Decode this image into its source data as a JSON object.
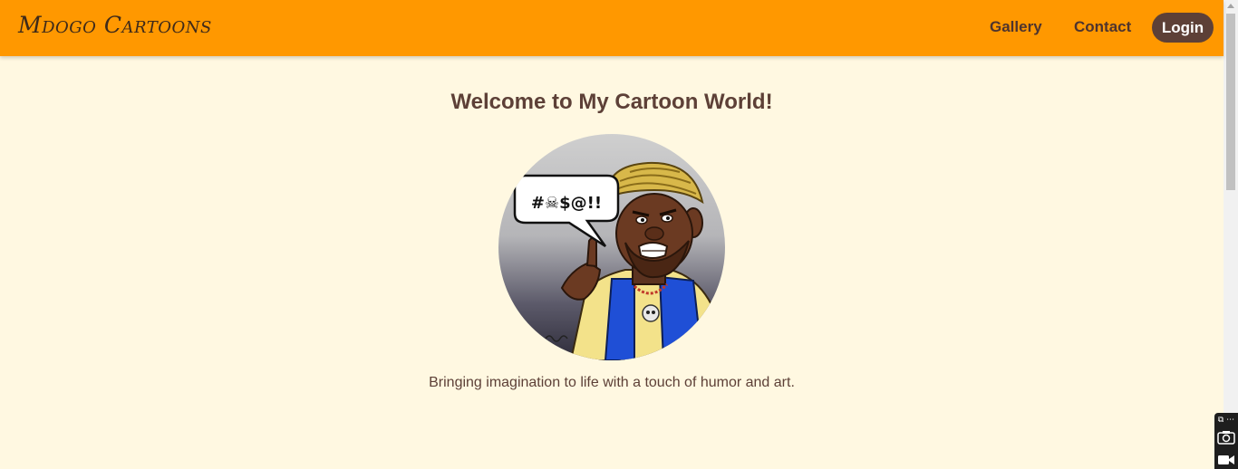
{
  "navbar": {
    "brand": "Mdogo Cartoons",
    "links": [
      "Gallery",
      "Contact"
    ],
    "login_label": "Login"
  },
  "hero": {
    "title": "Welcome to My Cartoon World!",
    "speech_text": "#☠$@!!",
    "tagline": "Bringing imagination to life with a touch of humor and art."
  },
  "colors": {
    "navbar_bg": "#ff9800",
    "page_bg": "#fff8e1",
    "text_brown": "#5d4037",
    "login_bg": "#5d4037"
  },
  "icons": {
    "capture_top": "⧉ ⋯",
    "camera": "camera-icon",
    "video": "video-icon"
  }
}
